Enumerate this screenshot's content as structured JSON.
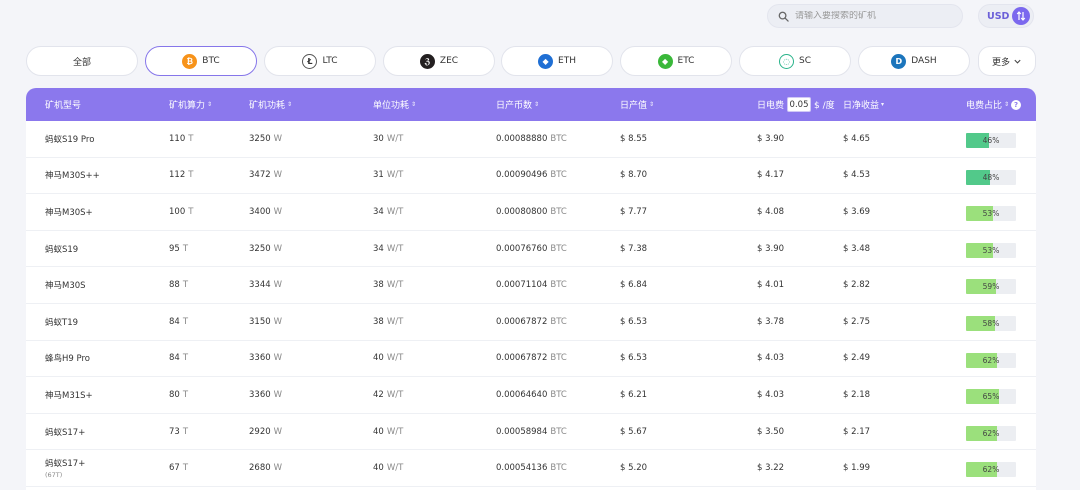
{
  "search": {
    "placeholder": "请输入要搜索的矿机"
  },
  "currency": {
    "label": "USD"
  },
  "coins": [
    {
      "label": "全部",
      "icon": "",
      "icon_color": "",
      "icon_name": ""
    },
    {
      "label": "BTC",
      "icon": "₿",
      "icon_color": "#f7931a",
      "icon_name": "btc-icon"
    },
    {
      "label": "LTC",
      "icon": "Ł",
      "icon_color": "#ffffff",
      "icon_name": "ltc-icon"
    },
    {
      "label": "ZEC",
      "icon": "ℨ",
      "icon_color": "#231f20",
      "icon_name": "zec-icon"
    },
    {
      "label": "ETH",
      "icon": "◆",
      "icon_color": "#1f6fd4",
      "icon_name": "eth-icon"
    },
    {
      "label": "ETC",
      "icon": "◆",
      "icon_color": "#3ab83a",
      "icon_name": "etc-icon"
    },
    {
      "label": "SC",
      "icon": "◌",
      "icon_color": "#ffffff",
      "icon_name": "sc-icon"
    },
    {
      "label": "DASH",
      "icon": "D",
      "icon_color": "#1c75bc",
      "icon_name": "dash-icon"
    }
  ],
  "more_label": "更多",
  "header": {
    "model": "矿机型号",
    "hashrate": "矿机算力",
    "power": "矿机功耗",
    "efficiency": "单位功耗",
    "daily_coin": "日产币数",
    "daily_value": "日产值",
    "elec_label": "日电费",
    "elec_price": "0.05",
    "elec_unit": "$ /度",
    "net_profit": "日净收益",
    "elec_ratio": "电费占比"
  },
  "rows": [
    {
      "model": "蚂蚁S19 Pro",
      "sub": "",
      "hash": "110",
      "hash_unit": "T",
      "power": "3250",
      "power_unit": "W",
      "eff": "30",
      "eff_unit": "W/T",
      "coin": "0.00088880",
      "coin_unit": "BTC",
      "value": "$ 8.55",
      "elec": "$ 3.90",
      "net": "$ 4.65",
      "ratio": 46,
      "ratio_label": "46%"
    },
    {
      "model": "神马M30S++",
      "sub": "",
      "hash": "112",
      "hash_unit": "T",
      "power": "3472",
      "power_unit": "W",
      "eff": "31",
      "eff_unit": "W/T",
      "coin": "0.00090496",
      "coin_unit": "BTC",
      "value": "$ 8.70",
      "elec": "$ 4.17",
      "net": "$ 4.53",
      "ratio": 48,
      "ratio_label": "48%"
    },
    {
      "model": "神马M30S+",
      "sub": "",
      "hash": "100",
      "hash_unit": "T",
      "power": "3400",
      "power_unit": "W",
      "eff": "34",
      "eff_unit": "W/T",
      "coin": "0.00080800",
      "coin_unit": "BTC",
      "value": "$ 7.77",
      "elec": "$ 4.08",
      "net": "$ 3.69",
      "ratio": 53,
      "ratio_label": "53%"
    },
    {
      "model": "蚂蚁S19",
      "sub": "",
      "hash": "95",
      "hash_unit": "T",
      "power": "3250",
      "power_unit": "W",
      "eff": "34",
      "eff_unit": "W/T",
      "coin": "0.00076760",
      "coin_unit": "BTC",
      "value": "$ 7.38",
      "elec": "$ 3.90",
      "net": "$ 3.48",
      "ratio": 53,
      "ratio_label": "53%"
    },
    {
      "model": "神马M30S",
      "sub": "",
      "hash": "88",
      "hash_unit": "T",
      "power": "3344",
      "power_unit": "W",
      "eff": "38",
      "eff_unit": "W/T",
      "coin": "0.00071104",
      "coin_unit": "BTC",
      "value": "$ 6.84",
      "elec": "$ 4.01",
      "net": "$ 2.82",
      "ratio": 59,
      "ratio_label": "59%"
    },
    {
      "model": "蚂蚁T19",
      "sub": "",
      "hash": "84",
      "hash_unit": "T",
      "power": "3150",
      "power_unit": "W",
      "eff": "38",
      "eff_unit": "W/T",
      "coin": "0.00067872",
      "coin_unit": "BTC",
      "value": "$ 6.53",
      "elec": "$ 3.78",
      "net": "$ 2.75",
      "ratio": 58,
      "ratio_label": "58%"
    },
    {
      "model": "蜂鸟H9 Pro",
      "sub": "",
      "hash": "84",
      "hash_unit": "T",
      "power": "3360",
      "power_unit": "W",
      "eff": "40",
      "eff_unit": "W/T",
      "coin": "0.00067872",
      "coin_unit": "BTC",
      "value": "$ 6.53",
      "elec": "$ 4.03",
      "net": "$ 2.49",
      "ratio": 62,
      "ratio_label": "62%"
    },
    {
      "model": "神马M31S+",
      "sub": "",
      "hash": "80",
      "hash_unit": "T",
      "power": "3360",
      "power_unit": "W",
      "eff": "42",
      "eff_unit": "W/T",
      "coin": "0.00064640",
      "coin_unit": "BTC",
      "value": "$ 6.21",
      "elec": "$ 4.03",
      "net": "$ 2.18",
      "ratio": 65,
      "ratio_label": "65%"
    },
    {
      "model": "蚂蚁S17+",
      "sub": "",
      "hash": "73",
      "hash_unit": "T",
      "power": "2920",
      "power_unit": "W",
      "eff": "40",
      "eff_unit": "W/T",
      "coin": "0.00058984",
      "coin_unit": "BTC",
      "value": "$ 5.67",
      "elec": "$ 3.50",
      "net": "$ 2.17",
      "ratio": 62,
      "ratio_label": "62%"
    },
    {
      "model": "蚂蚁S17+",
      "sub": "(67T)",
      "hash": "67",
      "hash_unit": "T",
      "power": "2680",
      "power_unit": "W",
      "eff": "40",
      "eff_unit": "W/T",
      "coin": "0.00054136",
      "coin_unit": "BTC",
      "value": "$ 5.20",
      "elec": "$ 3.22",
      "net": "$ 1.99",
      "ratio": 62,
      "ratio_label": "62%"
    }
  ],
  "colors": {
    "accent": "#8b78ed",
    "bar_dark": "#52c98a",
    "bar_light": "#9be07c"
  }
}
